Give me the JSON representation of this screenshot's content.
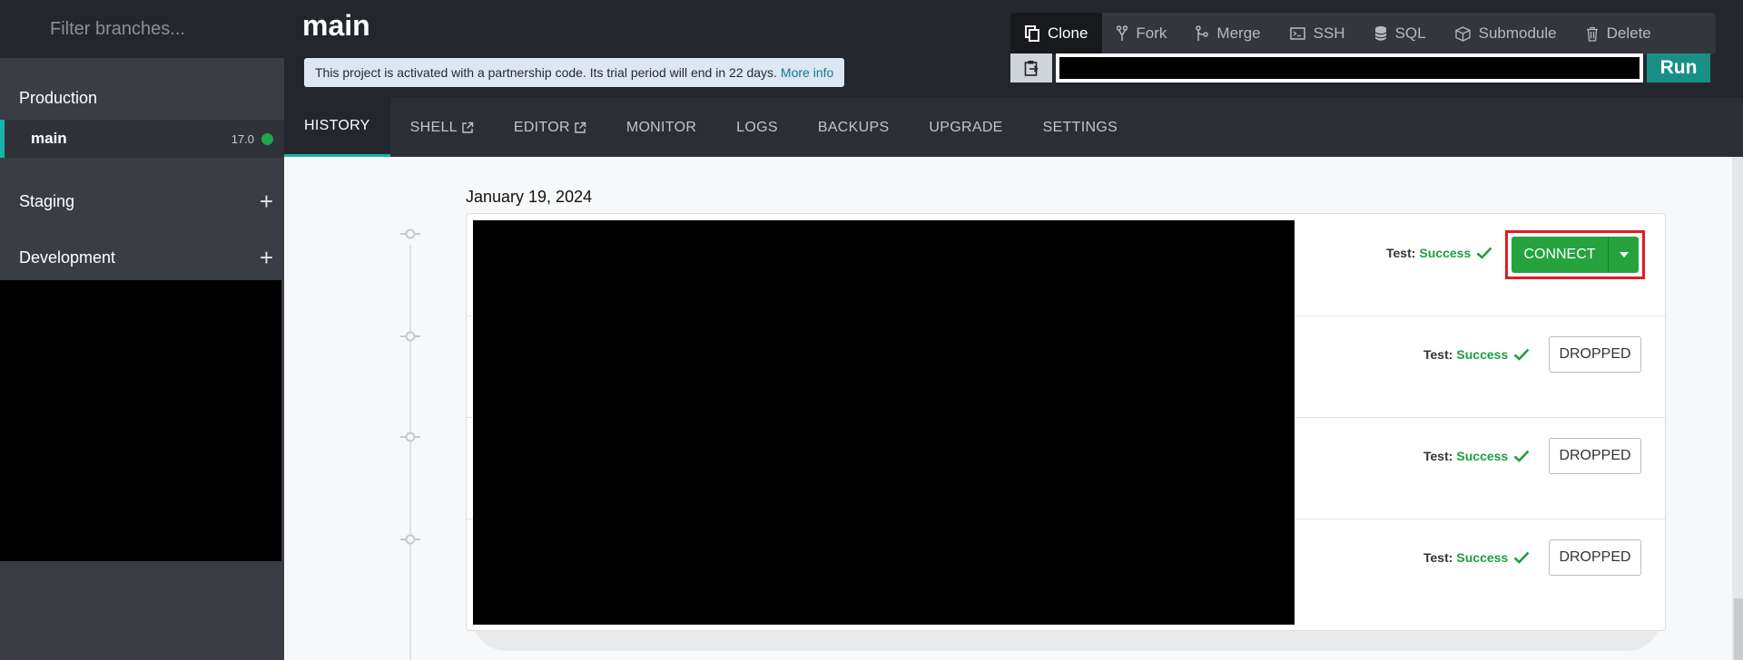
{
  "sidebar": {
    "filter_placeholder": "Filter branches...",
    "groups": {
      "production": {
        "label": "Production"
      },
      "staging": {
        "label": "Staging",
        "add_icon": "plus-icon"
      },
      "development": {
        "label": "Development",
        "add_icon": "plus-icon"
      }
    },
    "active_branch": {
      "name": "main",
      "version": "17.0",
      "status_color": "#1fa64a"
    }
  },
  "header": {
    "title": "main",
    "notice": {
      "text": "This project is activated with a partnership code. Its trial period will end in 22 days.",
      "link": "More info"
    }
  },
  "actions": [
    {
      "label": "Clone",
      "icon": "clone-icon",
      "active": true
    },
    {
      "label": "Fork",
      "icon": "fork-icon"
    },
    {
      "label": "Merge",
      "icon": "merge-icon"
    },
    {
      "label": "SSH",
      "icon": "terminal-icon"
    },
    {
      "label": "SQL",
      "icon": "database-icon"
    },
    {
      "label": "Submodule",
      "icon": "cube-icon"
    },
    {
      "label": "Delete",
      "icon": "trash-icon"
    }
  ],
  "command": {
    "run_label": "Run",
    "copy_icon": "clipboard-icon"
  },
  "tabs": [
    {
      "label": "HISTORY",
      "active": true
    },
    {
      "label": "SHELL",
      "external": true
    },
    {
      "label": "EDITOR",
      "external": true
    },
    {
      "label": "MONITOR"
    },
    {
      "label": "LOGS"
    },
    {
      "label": "BACKUPS"
    },
    {
      "label": "UPGRADE"
    },
    {
      "label": "SETTINGS"
    }
  ],
  "history": {
    "date": "January 19, 2024",
    "rows": [
      {
        "test_label": "Test:",
        "test_status": "Success",
        "action": "CONNECT"
      },
      {
        "test_label": "Test:",
        "test_status": "Success",
        "action": "DROPPED"
      },
      {
        "test_label": "Test:",
        "test_status": "Success",
        "action": "DROPPED"
      },
      {
        "test_label": "Test:",
        "test_status": "Success",
        "action": "DROPPED"
      }
    ]
  },
  "colors": {
    "accent": "#17b3a6",
    "success": "#1f9e3e",
    "connect_button": "#26a33e",
    "run_button": "#1a8f87",
    "highlight_box": "#e01b24"
  }
}
